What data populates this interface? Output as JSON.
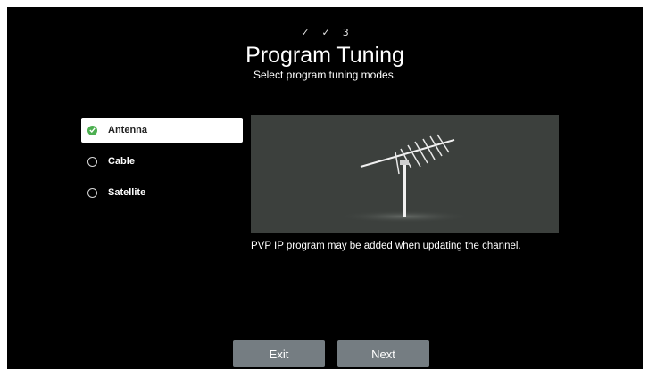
{
  "steps": [
    "✓",
    "✓",
    "3"
  ],
  "title": "Program Tuning",
  "subtitle": "Select program tuning modes.",
  "options": [
    {
      "label": "Antenna",
      "selected": true
    },
    {
      "label": "Cable",
      "selected": false
    },
    {
      "label": "Satellite",
      "selected": false
    }
  ],
  "preview": {
    "icon": "antenna-illustration"
  },
  "info_text": "PVP IP program may be added when updating the channel.",
  "buttons": {
    "exit_label": "Exit",
    "next_label": "Next"
  },
  "colors": {
    "accent": "#4caf50",
    "button": "#757d82",
    "preview_bg": "#3c403d"
  }
}
